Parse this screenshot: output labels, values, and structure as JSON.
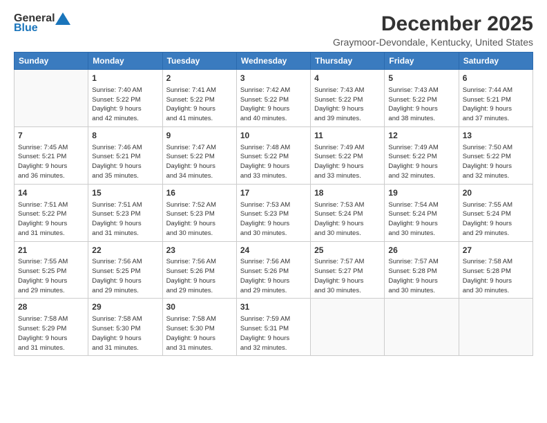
{
  "logo": {
    "general": "General",
    "blue": "Blue"
  },
  "title": {
    "month_year": "December 2025",
    "location": "Graymoor-Devondale, Kentucky, United States"
  },
  "weekdays": [
    "Sunday",
    "Monday",
    "Tuesday",
    "Wednesday",
    "Thursday",
    "Friday",
    "Saturday"
  ],
  "weeks": [
    [
      {
        "day": "",
        "info": ""
      },
      {
        "day": "1",
        "info": "Sunrise: 7:40 AM\nSunset: 5:22 PM\nDaylight: 9 hours\nand 42 minutes."
      },
      {
        "day": "2",
        "info": "Sunrise: 7:41 AM\nSunset: 5:22 PM\nDaylight: 9 hours\nand 41 minutes."
      },
      {
        "day": "3",
        "info": "Sunrise: 7:42 AM\nSunset: 5:22 PM\nDaylight: 9 hours\nand 40 minutes."
      },
      {
        "day": "4",
        "info": "Sunrise: 7:43 AM\nSunset: 5:22 PM\nDaylight: 9 hours\nand 39 minutes."
      },
      {
        "day": "5",
        "info": "Sunrise: 7:43 AM\nSunset: 5:22 PM\nDaylight: 9 hours\nand 38 minutes."
      },
      {
        "day": "6",
        "info": "Sunrise: 7:44 AM\nSunset: 5:21 PM\nDaylight: 9 hours\nand 37 minutes."
      }
    ],
    [
      {
        "day": "7",
        "info": "Sunrise: 7:45 AM\nSunset: 5:21 PM\nDaylight: 9 hours\nand 36 minutes."
      },
      {
        "day": "8",
        "info": "Sunrise: 7:46 AM\nSunset: 5:21 PM\nDaylight: 9 hours\nand 35 minutes."
      },
      {
        "day": "9",
        "info": "Sunrise: 7:47 AM\nSunset: 5:22 PM\nDaylight: 9 hours\nand 34 minutes."
      },
      {
        "day": "10",
        "info": "Sunrise: 7:48 AM\nSunset: 5:22 PM\nDaylight: 9 hours\nand 33 minutes."
      },
      {
        "day": "11",
        "info": "Sunrise: 7:49 AM\nSunset: 5:22 PM\nDaylight: 9 hours\nand 33 minutes."
      },
      {
        "day": "12",
        "info": "Sunrise: 7:49 AM\nSunset: 5:22 PM\nDaylight: 9 hours\nand 32 minutes."
      },
      {
        "day": "13",
        "info": "Sunrise: 7:50 AM\nSunset: 5:22 PM\nDaylight: 9 hours\nand 32 minutes."
      }
    ],
    [
      {
        "day": "14",
        "info": "Sunrise: 7:51 AM\nSunset: 5:22 PM\nDaylight: 9 hours\nand 31 minutes."
      },
      {
        "day": "15",
        "info": "Sunrise: 7:51 AM\nSunset: 5:23 PM\nDaylight: 9 hours\nand 31 minutes."
      },
      {
        "day": "16",
        "info": "Sunrise: 7:52 AM\nSunset: 5:23 PM\nDaylight: 9 hours\nand 30 minutes."
      },
      {
        "day": "17",
        "info": "Sunrise: 7:53 AM\nSunset: 5:23 PM\nDaylight: 9 hours\nand 30 minutes."
      },
      {
        "day": "18",
        "info": "Sunrise: 7:53 AM\nSunset: 5:24 PM\nDaylight: 9 hours\nand 30 minutes."
      },
      {
        "day": "19",
        "info": "Sunrise: 7:54 AM\nSunset: 5:24 PM\nDaylight: 9 hours\nand 30 minutes."
      },
      {
        "day": "20",
        "info": "Sunrise: 7:55 AM\nSunset: 5:24 PM\nDaylight: 9 hours\nand 29 minutes."
      }
    ],
    [
      {
        "day": "21",
        "info": "Sunrise: 7:55 AM\nSunset: 5:25 PM\nDaylight: 9 hours\nand 29 minutes."
      },
      {
        "day": "22",
        "info": "Sunrise: 7:56 AM\nSunset: 5:25 PM\nDaylight: 9 hours\nand 29 minutes."
      },
      {
        "day": "23",
        "info": "Sunrise: 7:56 AM\nSunset: 5:26 PM\nDaylight: 9 hours\nand 29 minutes."
      },
      {
        "day": "24",
        "info": "Sunrise: 7:56 AM\nSunset: 5:26 PM\nDaylight: 9 hours\nand 29 minutes."
      },
      {
        "day": "25",
        "info": "Sunrise: 7:57 AM\nSunset: 5:27 PM\nDaylight: 9 hours\nand 30 minutes."
      },
      {
        "day": "26",
        "info": "Sunrise: 7:57 AM\nSunset: 5:28 PM\nDaylight: 9 hours\nand 30 minutes."
      },
      {
        "day": "27",
        "info": "Sunrise: 7:58 AM\nSunset: 5:28 PM\nDaylight: 9 hours\nand 30 minutes."
      }
    ],
    [
      {
        "day": "28",
        "info": "Sunrise: 7:58 AM\nSunset: 5:29 PM\nDaylight: 9 hours\nand 31 minutes."
      },
      {
        "day": "29",
        "info": "Sunrise: 7:58 AM\nSunset: 5:30 PM\nDaylight: 9 hours\nand 31 minutes."
      },
      {
        "day": "30",
        "info": "Sunrise: 7:58 AM\nSunset: 5:30 PM\nDaylight: 9 hours\nand 31 minutes."
      },
      {
        "day": "31",
        "info": "Sunrise: 7:59 AM\nSunset: 5:31 PM\nDaylight: 9 hours\nand 32 minutes."
      },
      {
        "day": "",
        "info": ""
      },
      {
        "day": "",
        "info": ""
      },
      {
        "day": "",
        "info": ""
      }
    ]
  ]
}
